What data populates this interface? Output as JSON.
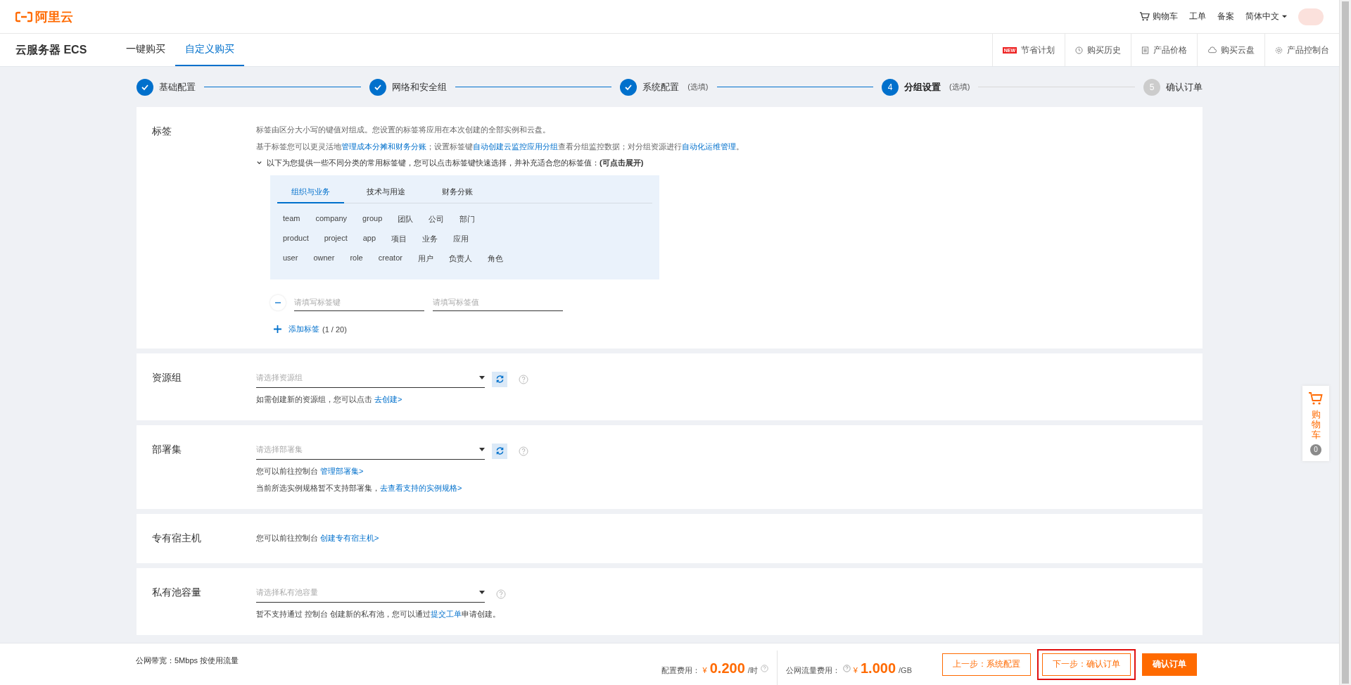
{
  "header": {
    "logo": "阿里云",
    "links": [
      {
        "label": "购物车",
        "kind": "cart"
      },
      {
        "label": "工单",
        "kind": "text"
      },
      {
        "label": "备案",
        "kind": "text"
      },
      {
        "label": "简体中文",
        "kind": "dropdown"
      }
    ]
  },
  "product_bar": {
    "title": "云服务器 ECS",
    "tabs": [
      {
        "label": "一键购买",
        "selected": false
      },
      {
        "label": "自定义购买",
        "selected": true
      }
    ],
    "tools": [
      {
        "label": "节省计划",
        "kind": "new",
        "badge": "NEW"
      },
      {
        "label": "购买历史",
        "kind": "clock"
      },
      {
        "label": "产品价格",
        "kind": "doc"
      },
      {
        "label": "购买云盘",
        "kind": "cloud"
      },
      {
        "label": "产品控制台",
        "kind": "gear"
      }
    ]
  },
  "steps": [
    {
      "label": "基础配置",
      "done": true,
      "current": false
    },
    {
      "label": "网络和安全组",
      "done": true,
      "current": false
    },
    {
      "label": "系统配置",
      "note": "(选填)",
      "done": true,
      "current": false
    },
    {
      "number": "4",
      "label": "分组设置",
      "note": "(选填)",
      "done": false,
      "current": true
    },
    {
      "number": "5",
      "label": "确认订单",
      "done": false,
      "current": false
    }
  ],
  "sections": [
    {
      "kind": "tags",
      "label": "标签",
      "intro": "标签由区分大小写的键值对组成。您设置的标签将应用在本次创建的全部实例和云盘。",
      "info": [
        {
          "text": "基于标签您可以更灵活地",
          "link": false
        },
        {
          "text": "管理成本分摊和财务分账",
          "link": true
        },
        {
          "text": "；设置标签键",
          "link": false
        },
        {
          "text": "自动创建云监控应用分组",
          "link": true
        },
        {
          "text": "查看分组监控数据；对分组资源进行",
          "link": false
        },
        {
          "text": "自动化运维管理",
          "link": true
        },
        {
          "text": "。",
          "link": false
        }
      ],
      "expander": {
        "text": "以下为您提供一些不同分类的常用标签键，您可以点击标签键快速选择，并补充适合您的标签值：**(可点击展开)**",
        "expanded": true
      },
      "panel_tabs": [
        {
          "label": "组织与业务",
          "selected": true
        },
        {
          "label": "技术与用途",
          "selected": false
        },
        {
          "label": "财务分账",
          "selected": false
        }
      ],
      "tag_keys": [
        [
          "team",
          "company",
          "group",
          "团队",
          "公司",
          "部门"
        ],
        [
          "product",
          "project",
          "app",
          "项目",
          "业务",
          "应用"
        ],
        [
          "user",
          "owner",
          "role",
          "creator",
          "用户",
          "负责人",
          "角色"
        ]
      ],
      "key_placeholder": "请填写标签键",
      "value_placeholder": "请填写标签值",
      "add_label": "添加标签",
      "add_count": "(1 / 20)"
    },
    {
      "kind": "select",
      "label": "资源组",
      "placeholder": "请选择资源组",
      "refresh": true,
      "help": true,
      "notes": [
        [
          {
            "text": "如需创建新的资源组，您可以点击 ",
            "link": false
          },
          {
            "text": "去创建>",
            "link": true
          }
        ]
      ]
    },
    {
      "kind": "select",
      "label": "部署集",
      "placeholder": "请选择部署集",
      "refresh": true,
      "help": true,
      "notes": [
        [
          {
            "text": "您可以前往控制台 ",
            "link": false
          },
          {
            "text": "管理部署集>",
            "link": true
          }
        ],
        [
          {
            "text": "当前所选实例规格暂不支持部署集，",
            "link": false
          },
          {
            "text": "去查看支持的实例规格>",
            "link": true
          }
        ]
      ]
    },
    {
      "kind": "info",
      "label": "专有宿主机",
      "notes": [
        [
          {
            "text": "您可以前往控制台 ",
            "link": false
          },
          {
            "text": "创建专有宿主机>",
            "link": true
          }
        ]
      ]
    },
    {
      "kind": "select",
      "label": "私有池容量",
      "placeholder": "请选择私有池容量",
      "refresh": false,
      "help": true,
      "notes": [
        [
          {
            "text": "暂不支持通过 控制台 创建新的私有池，您可以通过",
            "link": false
          },
          {
            "text": "提交工单",
            "link": true
          },
          {
            "text": "申请创建。",
            "link": false
          }
        ]
      ]
    }
  ],
  "footer": {
    "bandwidth": "公网带宽：5Mbps 按使用流量",
    "fees": [
      {
        "label": "配置费用：",
        "currency": "¥",
        "amount": "0.200",
        "unit": "/时",
        "help_before": false,
        "help_after": true
      },
      {
        "label": "公网流量费用：",
        "currency": "¥",
        "amount": "1.000",
        "unit": "/GB",
        "help_before": true,
        "help_after": false
      }
    ],
    "buttons": [
      {
        "label": "上一步：系统配置",
        "kind": "outline",
        "highlighted": false
      },
      {
        "label": "下一步：确认订单",
        "kind": "outline",
        "highlighted": true
      },
      {
        "label": "确认订单",
        "kind": "primary",
        "highlighted": false
      }
    ]
  },
  "float_cart": {
    "label": "购物车",
    "count": "0"
  }
}
